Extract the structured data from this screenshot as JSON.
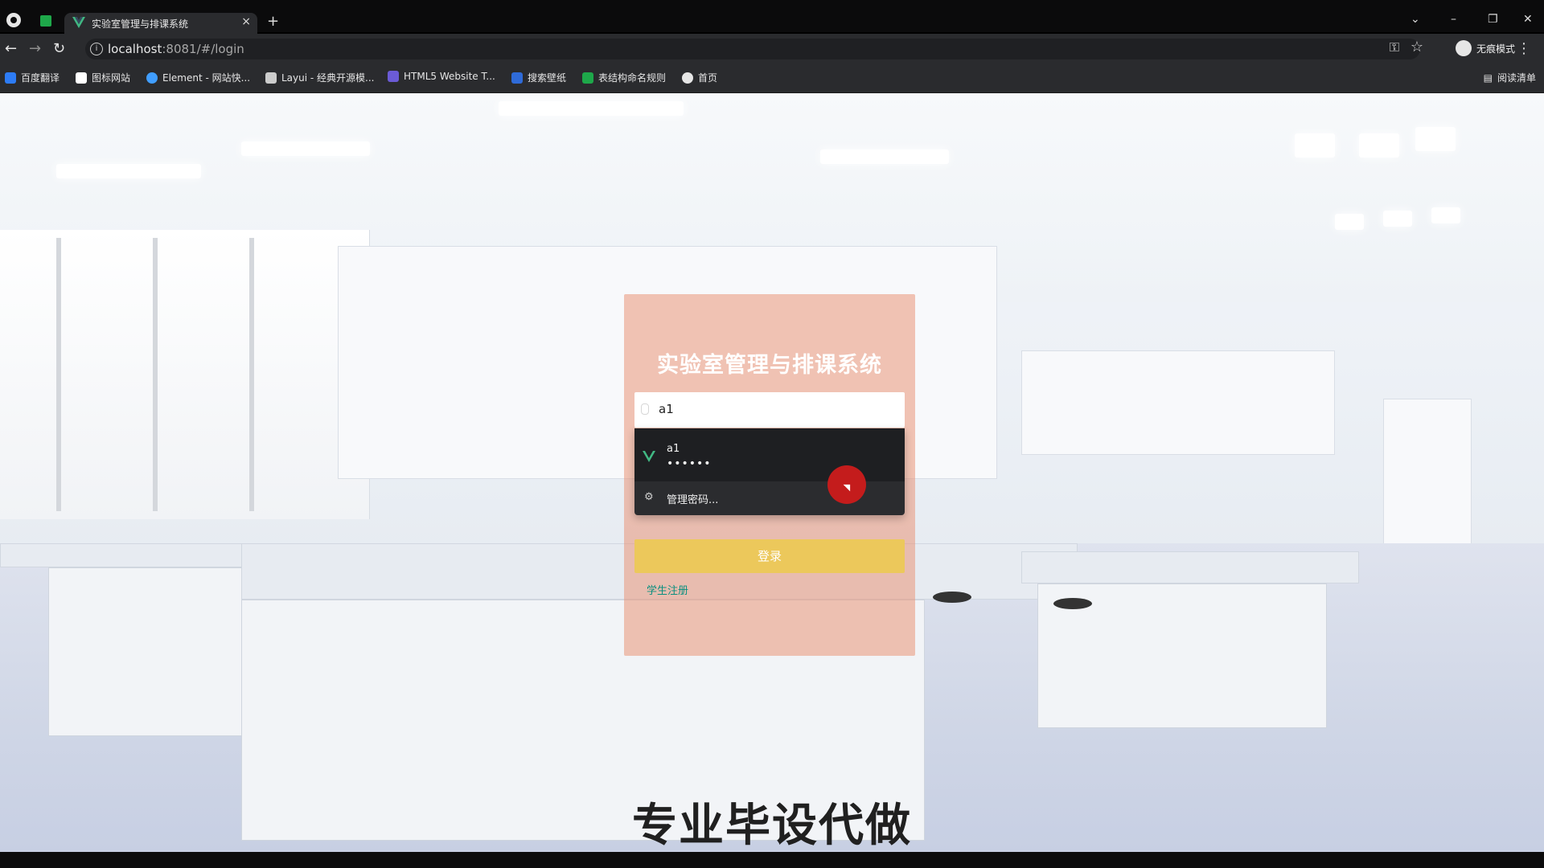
{
  "browser": {
    "tab_title": "实验室管理与排课系统",
    "tab_close": "×",
    "new_tab": "+",
    "url_main": "localhost",
    "url_rest": ":8081/#/login",
    "incognito_label": "无痕模式",
    "read_list": "阅读清单"
  },
  "bookmarks": [
    {
      "label": "百度翻译",
      "color": "#2d7cf6"
    },
    {
      "label": "图标网站",
      "color": "#ffffff"
    },
    {
      "label": "Element - 网站快...",
      "color": "#409eff"
    },
    {
      "label": "Layui - 经典开源模...",
      "color": "#cccccc"
    },
    {
      "label": "HTML5 Website T...",
      "color": "#6b5bd6"
    },
    {
      "label": "搜索壁纸",
      "color": "#2f6bd8"
    },
    {
      "label": "表结构命名规则",
      "color": "#1ea84a"
    },
    {
      "label": "首页",
      "color": "#e6e6e6"
    }
  ],
  "login": {
    "title": "实验室管理与排课系统",
    "username_value": "a1",
    "autofill": {
      "username": "a1",
      "password_mask": "••••••",
      "manage_label": "管理密码..."
    },
    "login_button": "登录",
    "register_link": "学生注册"
  },
  "colors": {
    "card_bg": "rgba(233,150,120,0.55)",
    "login_button": "#ecc85b",
    "register_link": "#0a8f7f",
    "vue_green": "#41b883"
  },
  "overlay": {
    "watermark": "专业毕设代做"
  }
}
